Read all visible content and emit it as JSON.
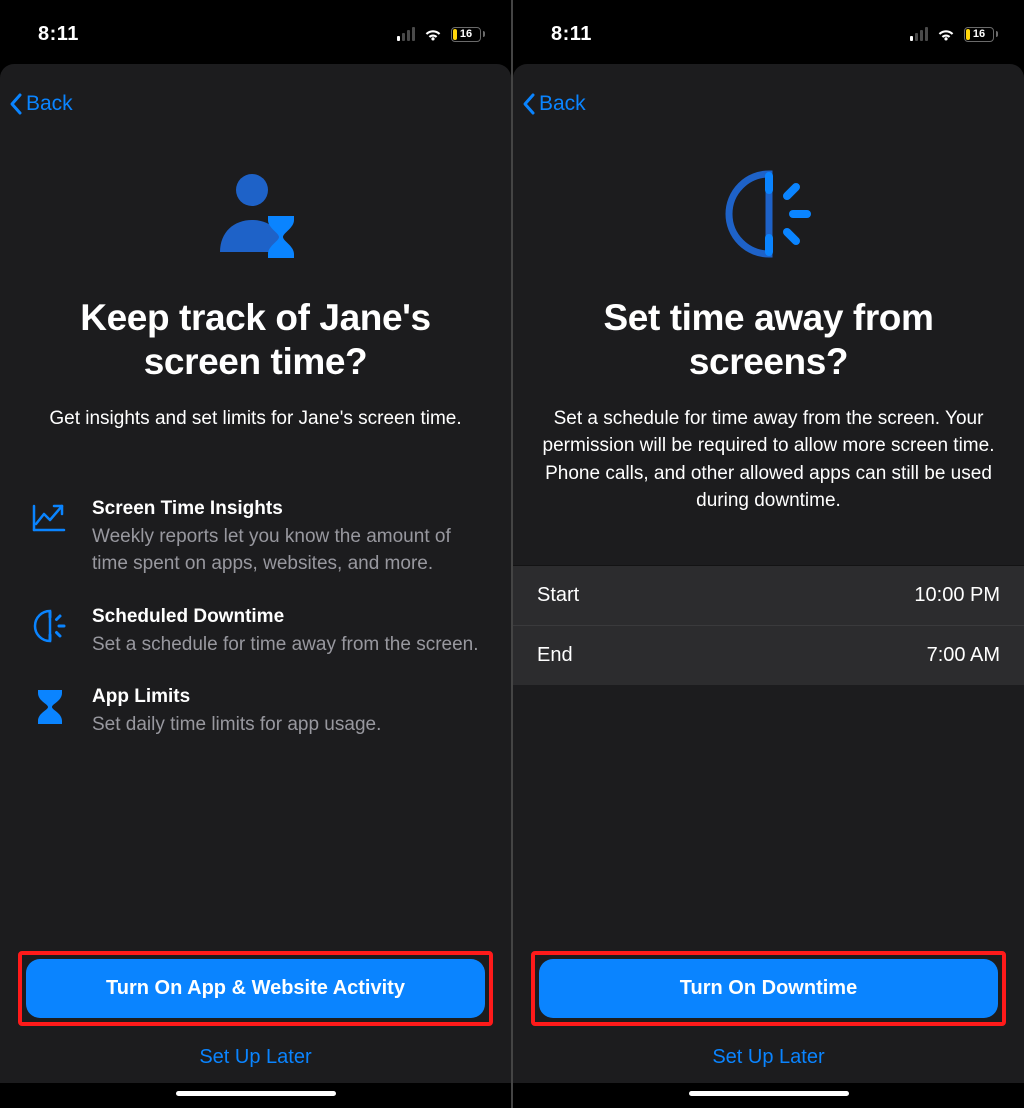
{
  "status": {
    "time": "8:11",
    "battery_pct": "16"
  },
  "colors": {
    "accent": "#0a84ff",
    "highlight": "#ff1a1a",
    "battery": "#ffd60a"
  },
  "left": {
    "back_label": "Back",
    "icon": "person-hourglass-icon",
    "title": "Keep track of Jane's screen time?",
    "subtitle": "Get insights and set limits for Jane's screen time.",
    "features": [
      {
        "icon": "chart-icon",
        "title": "Screen Time Insights",
        "desc": "Weekly reports let you know the amount of time spent on apps, websites, and more."
      },
      {
        "icon": "clock-half-icon",
        "title": "Scheduled Downtime",
        "desc": "Set a schedule for time away from the screen."
      },
      {
        "icon": "hourglass-icon",
        "title": "App Limits",
        "desc": "Set daily time limits for app usage."
      }
    ],
    "primary": "Turn On App & Website Activity",
    "secondary": "Set Up Later"
  },
  "right": {
    "back_label": "Back",
    "icon": "clock-half-icon",
    "title": "Set time away from screens?",
    "subtitle": "Set a schedule for time away from the screen. Your permission will be required to allow more screen time. Phone calls, and other allowed apps can still be used during downtime.",
    "schedule": {
      "start_label": "Start",
      "start_value": "10:00 PM",
      "end_label": "End",
      "end_value": "7:00 AM"
    },
    "primary": "Turn On Downtime",
    "secondary": "Set Up Later"
  }
}
